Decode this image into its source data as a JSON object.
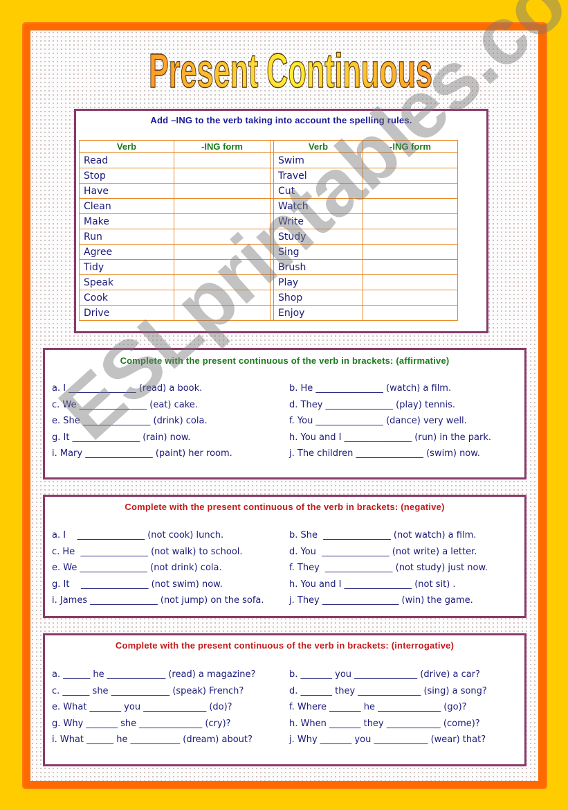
{
  "title": "Present Continuous",
  "watermark": "ESLprintables.com",
  "colors": {
    "background": "#ffcc00",
    "frame": "#ff6a00",
    "box_border": "#8a3a6a",
    "table_border": "#e88a2a",
    "text_blue": "#1a1a7a",
    "heading_green": "#1a7a1a",
    "heading_red": "#c41a1a"
  },
  "section1": {
    "heading": "Add –ING to the verb taking into account the spelling rules.",
    "headers": [
      "Verb",
      "-ING form",
      "Verb",
      "-ING form"
    ],
    "left_verbs": [
      "Read",
      "Stop",
      "Have",
      "Clean",
      "Make",
      "Run",
      "Agree",
      "Tidy",
      "Speak",
      "Cook",
      "Drive"
    ],
    "right_verbs": [
      "Swim",
      "Travel",
      "Cut",
      "Watch",
      "Write",
      "Study",
      "Sing",
      "Brush",
      "Play",
      "Shop",
      "Enjoy"
    ]
  },
  "section2": {
    "heading": "Complete with the present continuous of the verb in brackets: (affirmative)",
    "items": [
      "a. I _______________ (read) a book.",
      "b. He _______________ (watch) a film.",
      "c. We _______________ (eat) cake.",
      "d. They _______________ (play) tennis.",
      "e. She _______________ (drink) cola.",
      "f. You _______________ (dance) very well.",
      "g. It _______________ (rain) now.",
      "h. You and I _______________ (run) in the park.",
      "i. Mary _______________ (paint) her room.",
      "j. The children _______________ (swim) now."
    ]
  },
  "section3": {
    "heading": "Complete with the present continuous of the verb in brackets: (negative)",
    "items": [
      "a. I    _______________ (not cook) lunch.",
      "b. She  _______________ (not watch) a film.",
      "c. He  _______________ (not walk) to school.",
      "d. You  _______________ (not write) a letter.",
      "e. We _______________ (not drink) cola.",
      "f. They  _______________ (not study) just now.",
      "g. It    _______________ (not swim) now.",
      "h. You and I _______________ (not sit) .",
      "i. James _______________ (not jump) on the sofa.",
      "j. They _________________ (win) the game."
    ]
  },
  "section4": {
    "heading": "Complete with the present continuous of the verb in brackets: (interrogative)",
    "items": [
      "a. ______ he _____________ (read) a magazine?",
      "b. _______ you ______________ (drive) a car?",
      "c. ______ she _____________ (speak) French?",
      "d. _______ they ______________ (sing) a song?",
      "e. What _______ you ______________ (do)?",
      "f. Where _______ he ______________ (go)?",
      "g. Why _______ she ______________ (cry)?",
      "h. When _______ they ____________ (come)?",
      "i. What ______ he ___________ (dream) about?",
      "j. Why _______ you ____________ (wear) that?"
    ]
  }
}
